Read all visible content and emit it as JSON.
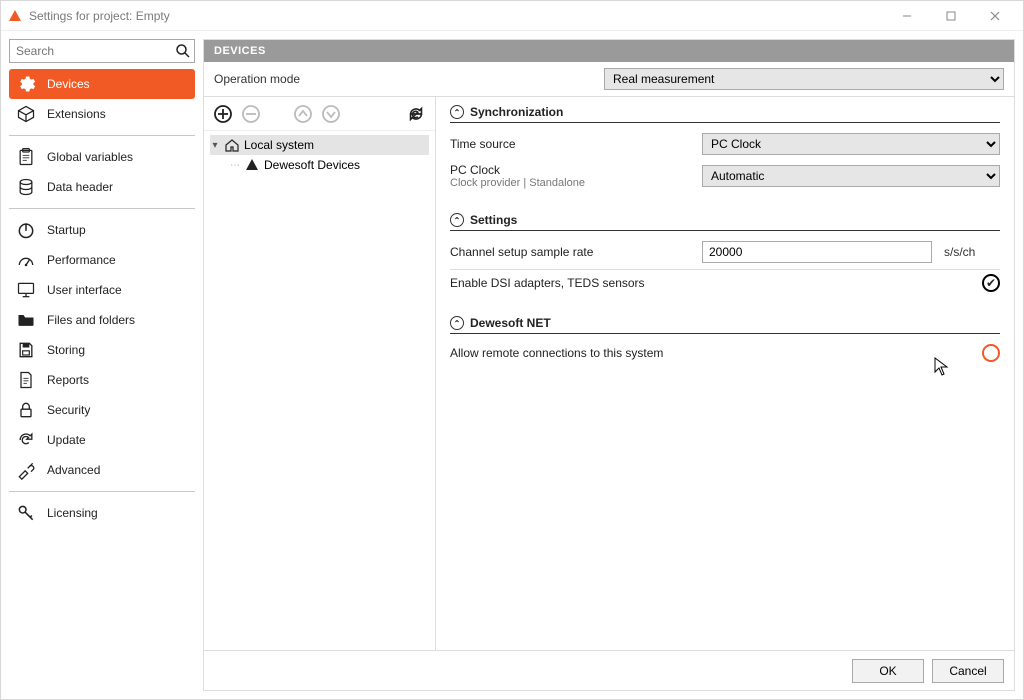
{
  "window": {
    "title": "Settings for project: Empty"
  },
  "search": {
    "placeholder": "Search"
  },
  "sidebar": {
    "items": [
      {
        "id": "devices",
        "label": "Devices",
        "active": true
      },
      {
        "id": "extensions",
        "label": "Extensions"
      }
    ],
    "section2": [
      {
        "id": "global-vars",
        "label": "Global variables"
      },
      {
        "id": "data-header",
        "label": "Data header"
      }
    ],
    "section3": [
      {
        "id": "startup",
        "label": "Startup"
      },
      {
        "id": "performance",
        "label": "Performance"
      },
      {
        "id": "ui",
        "label": "User interface"
      },
      {
        "id": "files",
        "label": "Files and folders"
      },
      {
        "id": "storing",
        "label": "Storing"
      },
      {
        "id": "reports",
        "label": "Reports"
      },
      {
        "id": "security",
        "label": "Security"
      },
      {
        "id": "update",
        "label": "Update"
      },
      {
        "id": "advanced",
        "label": "Advanced"
      }
    ],
    "section4": [
      {
        "id": "licensing",
        "label": "Licensing"
      }
    ]
  },
  "panel": {
    "header": "DEVICES",
    "opmode_label": "Operation mode",
    "opmode_value": "Real measurement"
  },
  "tree": {
    "root": "Local system",
    "child": "Dewesoft Devices"
  },
  "sync": {
    "title": "Synchronization",
    "time_source_label": "Time source",
    "time_source_value": "PC Clock",
    "pcclock_label": "PC Clock",
    "pcclock_sub": "Clock provider | Standalone",
    "pcclock_value": "Automatic"
  },
  "settings": {
    "title": "Settings",
    "rate_label": "Channel setup sample rate",
    "rate_value": "20000",
    "rate_unit": "s/s/ch",
    "dsi_label": "Enable DSI adapters, TEDS sensors",
    "dsi_checked": true
  },
  "net": {
    "title": "Dewesoft NET",
    "allow_label": "Allow remote connections to this system",
    "allow_checked": false
  },
  "footer": {
    "ok": "OK",
    "cancel": "Cancel"
  }
}
